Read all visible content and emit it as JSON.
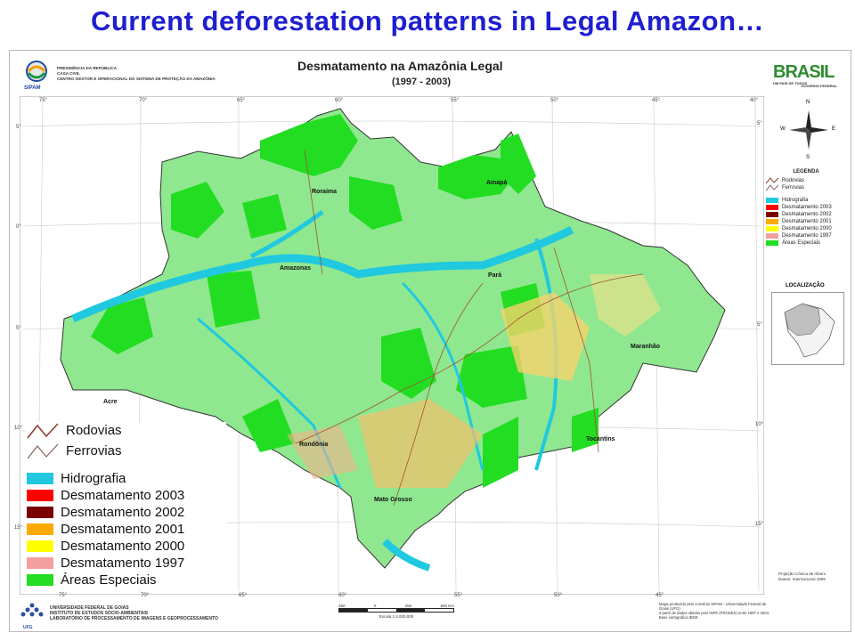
{
  "slide": {
    "title": "Current deforestation patterns in Legal Amazon…"
  },
  "map": {
    "title": "Desmatamento na Amazônia Legal",
    "subtitle": "(1997 - 2003)",
    "government": {
      "logo": "SIPAM",
      "lines": [
        "PRESIDÊNCIA DA REPÚBLICA",
        "CASA CIVIL",
        "CENTRO GESTOR E OPERACIONAL DO SISTEMA DE PROTEÇÃO DA AMAZÔNIA"
      ]
    },
    "brasil_logo": {
      "word": "BRASIL",
      "tagline": "UM PAÍS DE TODOS",
      "sub": "GOVERNO FEDERAL"
    },
    "longitudes": [
      "75°",
      "70°",
      "65°",
      "60°",
      "55°",
      "50°",
      "45°",
      "40°"
    ],
    "latitudes": [
      "5°",
      "0°",
      "5°",
      "10°",
      "15°"
    ],
    "state_labels": [
      "Roraima",
      "Amapá",
      "Amazonas",
      "Pará",
      "Maranhão",
      "Acre",
      "Rondônia",
      "Tocantins",
      "Mato Grosso"
    ],
    "compass": {
      "n": "N",
      "s": "S",
      "e": "E",
      "w": "W"
    },
    "legend_small": {
      "title": "LEGENDA",
      "items": [
        "Rodovias",
        "Ferrovias",
        "Hidrografia",
        "Desmatamento 2003",
        "Desmatamento 2002",
        "Desmatamento 2001",
        "Desmatamento 2000",
        "Desmatamento 1997",
        "Áreas Especiais"
      ]
    },
    "location": {
      "title": "LOCALIZAÇÃO"
    },
    "projection": [
      "Projeção Cônica de Albers",
      "Datum: Internacional 1909"
    ],
    "footer": {
      "logo": "UFG",
      "lines": [
        "UNIVERSIDADE FEDERAL DE GOIÁS",
        "INSTITUTO DE ESTUDOS SÓCIO-AMBIENTAIS",
        "LABORATÓRIO DE PROCESSAMENTO DE IMAGENS E GEOPROCESSAMENTO"
      ]
    },
    "scale": {
      "ticks": [
        "250",
        "0",
        "250",
        "500 Km"
      ],
      "label": "Escala 1:4.000.000"
    },
    "credits": [
      "Mapa produzido pelo convênio SIPAM - Universidade Federal de Goiás (UFG)",
      "a partir de dados obtidos pelo INPE (PRODES) entre 1997 e 2003.",
      "Base cartográfica IBGE"
    ]
  },
  "legend": {
    "items": [
      {
        "label": "Rodovias",
        "kind": "line",
        "color": "#8b3a2a"
      },
      {
        "label": "Ferrovias",
        "kind": "line",
        "color": "#8b6060"
      },
      {
        "label": "Hidrografia",
        "kind": "fill",
        "color": "#20c8e0"
      },
      {
        "label": "Desmatamento 2003",
        "kind": "fill",
        "color": "#ff0000"
      },
      {
        "label": "Desmatamento 2002",
        "kind": "fill",
        "color": "#7a0000"
      },
      {
        "label": "Desmatamento 2001",
        "kind": "fill",
        "color": "#ffaa00"
      },
      {
        "label": "Desmatamento 2000",
        "kind": "fill",
        "color": "#ffff00"
      },
      {
        "label": "Desmatamento 1997",
        "kind": "fill",
        "color": "#f5a0a0"
      },
      {
        "label": "Áreas Especiais",
        "kind": "fill",
        "color": "#22dd22"
      }
    ]
  },
  "colors": {
    "land": "#8fe88f",
    "special_areas": "#22dd22",
    "water": "#20c8e0",
    "outside": "#ffffff",
    "title": "#1f1fd0"
  }
}
